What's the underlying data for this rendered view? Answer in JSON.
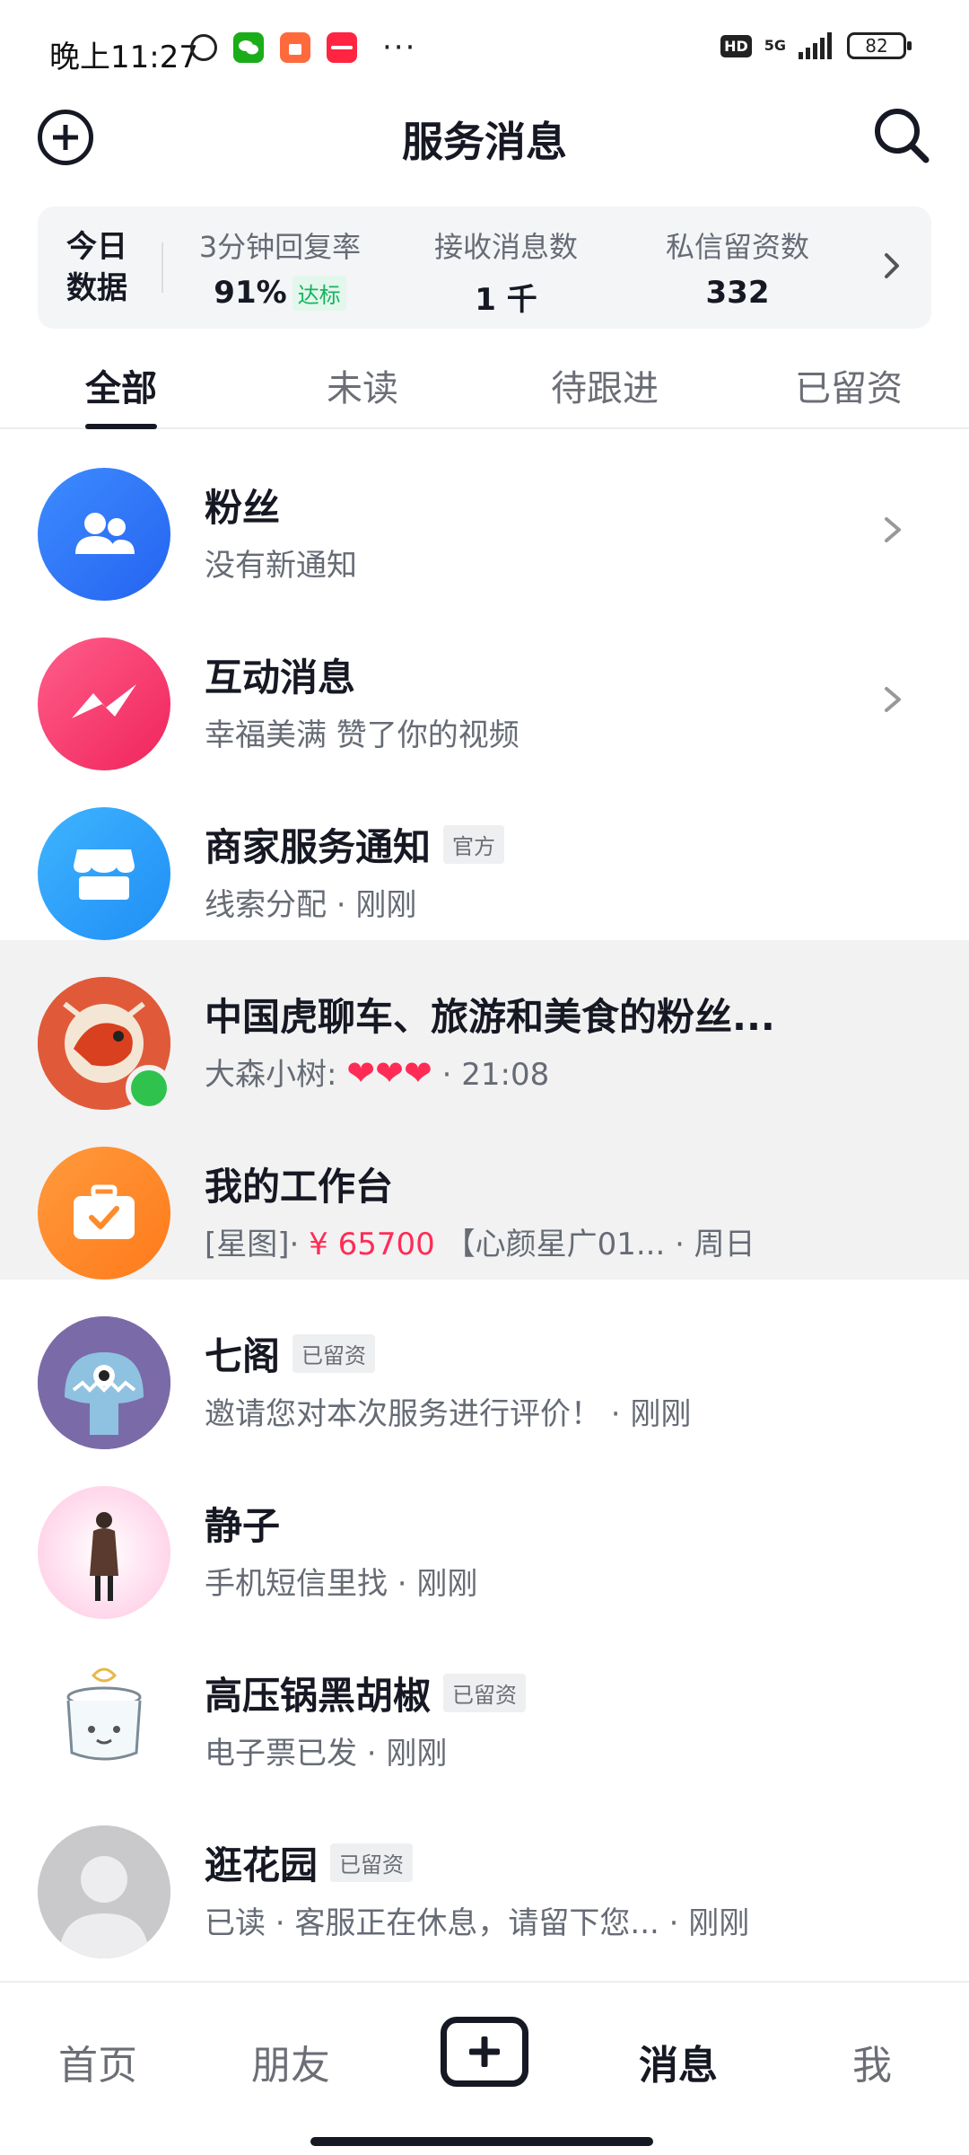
{
  "status_bar": {
    "time": "晚上11:27",
    "network": "5G",
    "hd": "HD",
    "battery": "82",
    "dots": "···"
  },
  "header": {
    "title": "服务消息"
  },
  "stats": {
    "today_label": "今日\n数据",
    "today_line1": "今日",
    "today_line2": "数据",
    "reply_rate_label": "3分钟回复率",
    "reply_rate_value": "91%",
    "reply_rate_badge": "达标",
    "received_label": "接收消息数",
    "received_value": "1 千",
    "leads_label": "私信留资数",
    "leads_value": "332"
  },
  "tabs": [
    {
      "label": "全部",
      "active": true
    },
    {
      "label": "未读",
      "active": false
    },
    {
      "label": "待跟进",
      "active": false
    },
    {
      "label": "已留资",
      "active": false
    }
  ],
  "messages": [
    {
      "title": "粉丝",
      "subtitle": "没有新通知"
    },
    {
      "title": "互动消息",
      "subtitle": "幸福美满 赞了你的视频"
    },
    {
      "title": "商家服务通知",
      "tag": "官方",
      "subtitle": "线索分配 · 刚刚"
    },
    {
      "title": "中国虎聊车、旅游和美食的粉丝...",
      "subtitle_prefix": "大森小树: ",
      "hearts": "❤❤❤",
      "subtitle_suffix": " · 21:08"
    },
    {
      "title": "我的工作台",
      "subtitle_prefix": "[星图]· ",
      "price": "¥ 65700",
      "subtitle_suffix": " 【心颜星广01...  · 周日"
    },
    {
      "title": "七阁",
      "tag": "已留资",
      "subtitle": "邀请您对本次服务进行评价！ · 刚刚"
    },
    {
      "title": "静子",
      "subtitle": "手机短信里找 · 刚刚"
    },
    {
      "title": "高压锅黑胡椒",
      "tag": "已留资",
      "subtitle": "电子票已发 · 刚刚"
    },
    {
      "title": "逛花园",
      "tag": "已留资",
      "subtitle": "已读 · 客服正在休息，请留下您... · 刚刚"
    }
  ],
  "bottom_nav": {
    "home": "首页",
    "friends": "朋友",
    "messages": "消息",
    "me": "我"
  },
  "colors": {
    "primary_text": "#161823",
    "secondary_text": "#666b75",
    "accent_red": "#fe2c55",
    "badge_green": "#17b35f",
    "online_green": "#2fc34e"
  }
}
